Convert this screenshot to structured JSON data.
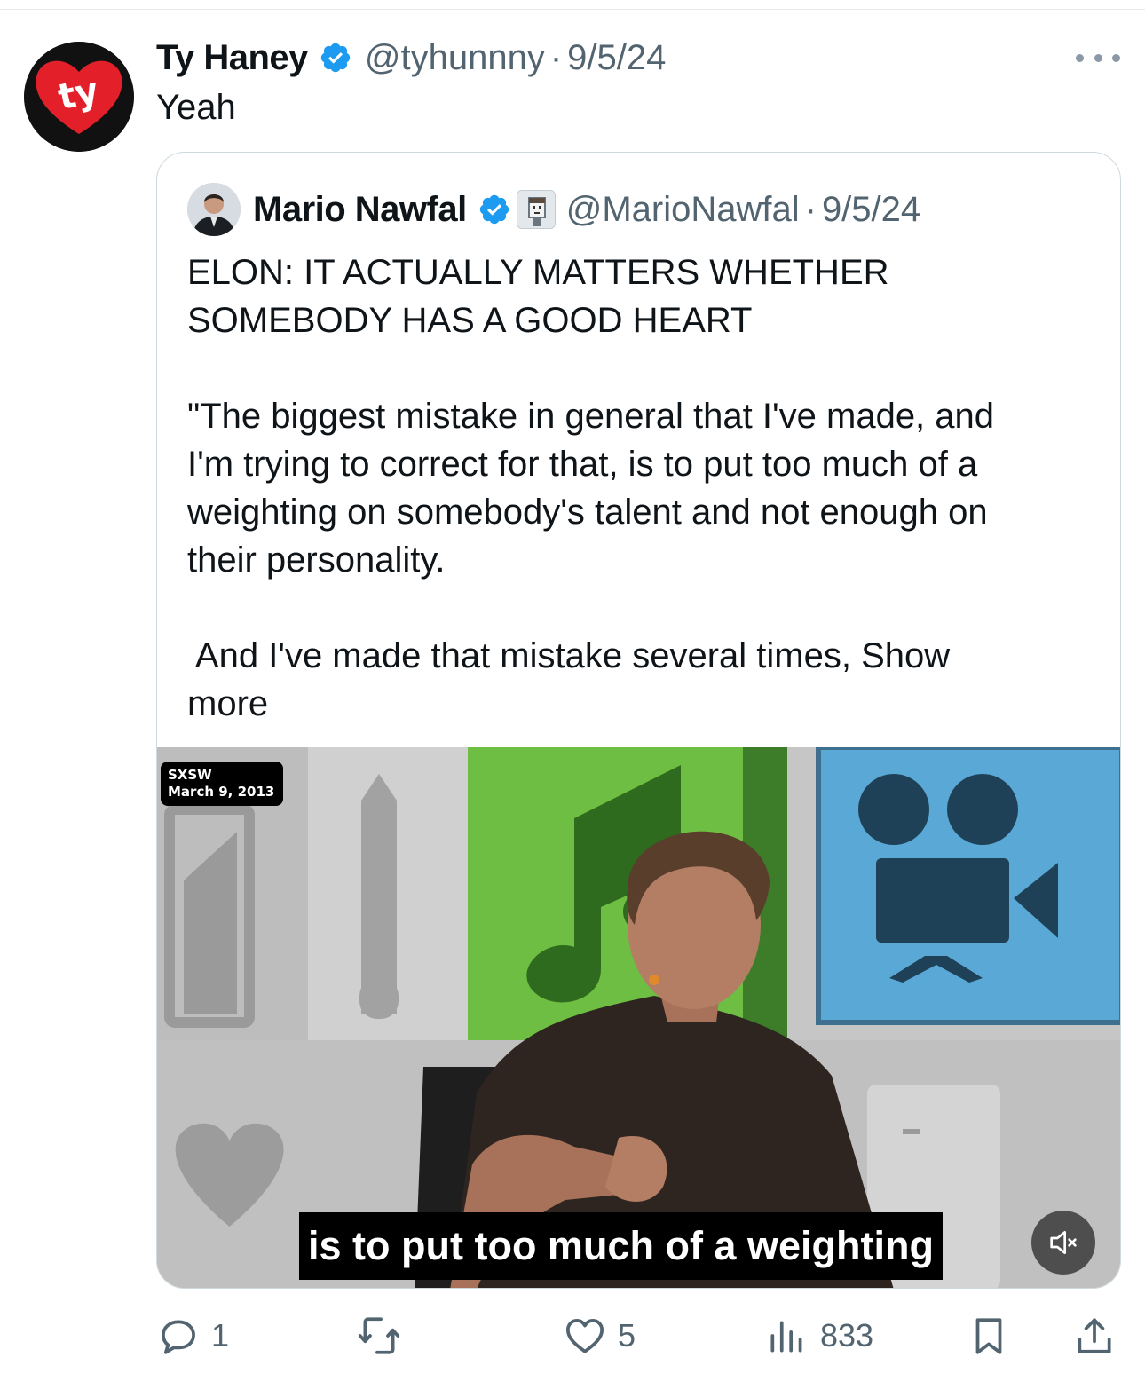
{
  "tweet": {
    "author_name": "Ty Haney",
    "handle": "@tyhunnny",
    "separator": "·",
    "date": "9/5/24",
    "text": "Yeah",
    "avatar_text": "ty"
  },
  "quote": {
    "author_name": "Mario Nawfal",
    "handle": "@MarioNawfal",
    "separator": "·",
    "date": "9/5/24",
    "headline_line1": "ELON: IT ACTUALLY MATTERS WHETHER",
    "headline_line2": "SOMEBODY HAS A GOOD HEART",
    "quote_line1": "\"The biggest mistake in general that I've made, and",
    "quote_line2": "I'm trying to correct for that, is to put too much of a",
    "quote_line3": "weighting on somebody's talent and not enough on",
    "quote_line4": "their personality.",
    "quote_line5": " And I've made that mistake several times,",
    "show_more_1": "Show",
    "show_more_2": "more"
  },
  "video": {
    "tag_line1": "SXSW",
    "tag_line2": "March 9, 2013",
    "caption": "is to put too much of a weighting",
    "muted": true
  },
  "actions": {
    "replies": "1",
    "reposts": "",
    "likes": "5",
    "views": "833"
  },
  "colors": {
    "text": "#0f1419",
    "secondary": "#536471",
    "verified": "#1d9bf0",
    "border": "#cfd9de"
  }
}
